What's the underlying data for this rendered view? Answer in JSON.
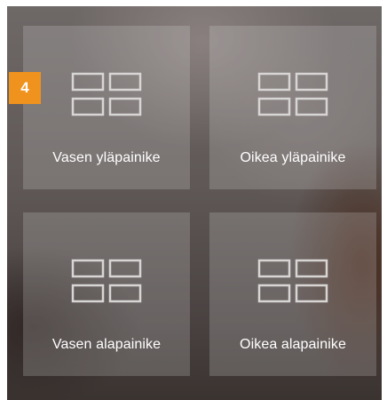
{
  "badge": {
    "number": "4",
    "color": "#f0921e"
  },
  "buttons": [
    {
      "label": "Vasen yläpainike",
      "icon": "grid-icon"
    },
    {
      "label": "Oikea yläpainike",
      "icon": "grid-icon"
    },
    {
      "label": "Vasen alapainike",
      "icon": "grid-icon"
    },
    {
      "label": "Oikea alapainike",
      "icon": "grid-icon"
    }
  ]
}
